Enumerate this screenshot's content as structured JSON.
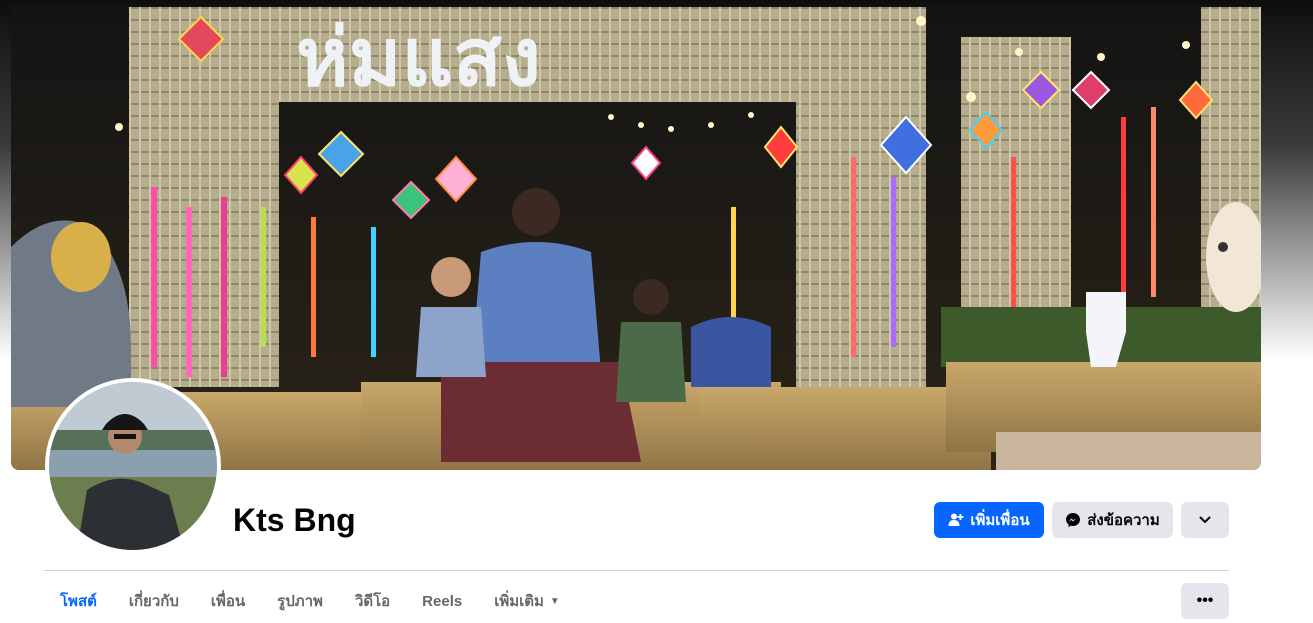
{
  "profile": {
    "name": "Kts Bng",
    "cover_sign_text": "ห่มแสง"
  },
  "actions": {
    "add_friend_label": "เพิ่มเพื่อน",
    "message_label": "ส่งข้อความ",
    "dropdown_icon": "chevron-down-icon"
  },
  "tabs": [
    {
      "label": "โพสต์",
      "active": true
    },
    {
      "label": "เกี่ยวกับ",
      "active": false
    },
    {
      "label": "เพื่อน",
      "active": false
    },
    {
      "label": "รูปภาพ",
      "active": false
    },
    {
      "label": "วิดีโอ",
      "active": false
    },
    {
      "label": "Reels",
      "active": false
    },
    {
      "label": "เพิ่มเติม",
      "active": false
    }
  ],
  "tab_more_icon": "caret-down-icon",
  "overflow_menu_icon": "more-horizontal-icon",
  "colors": {
    "primary": "#0866ff",
    "secondary_button": "#e4e6eb",
    "text": "#050505",
    "muted_text": "#65676b"
  }
}
